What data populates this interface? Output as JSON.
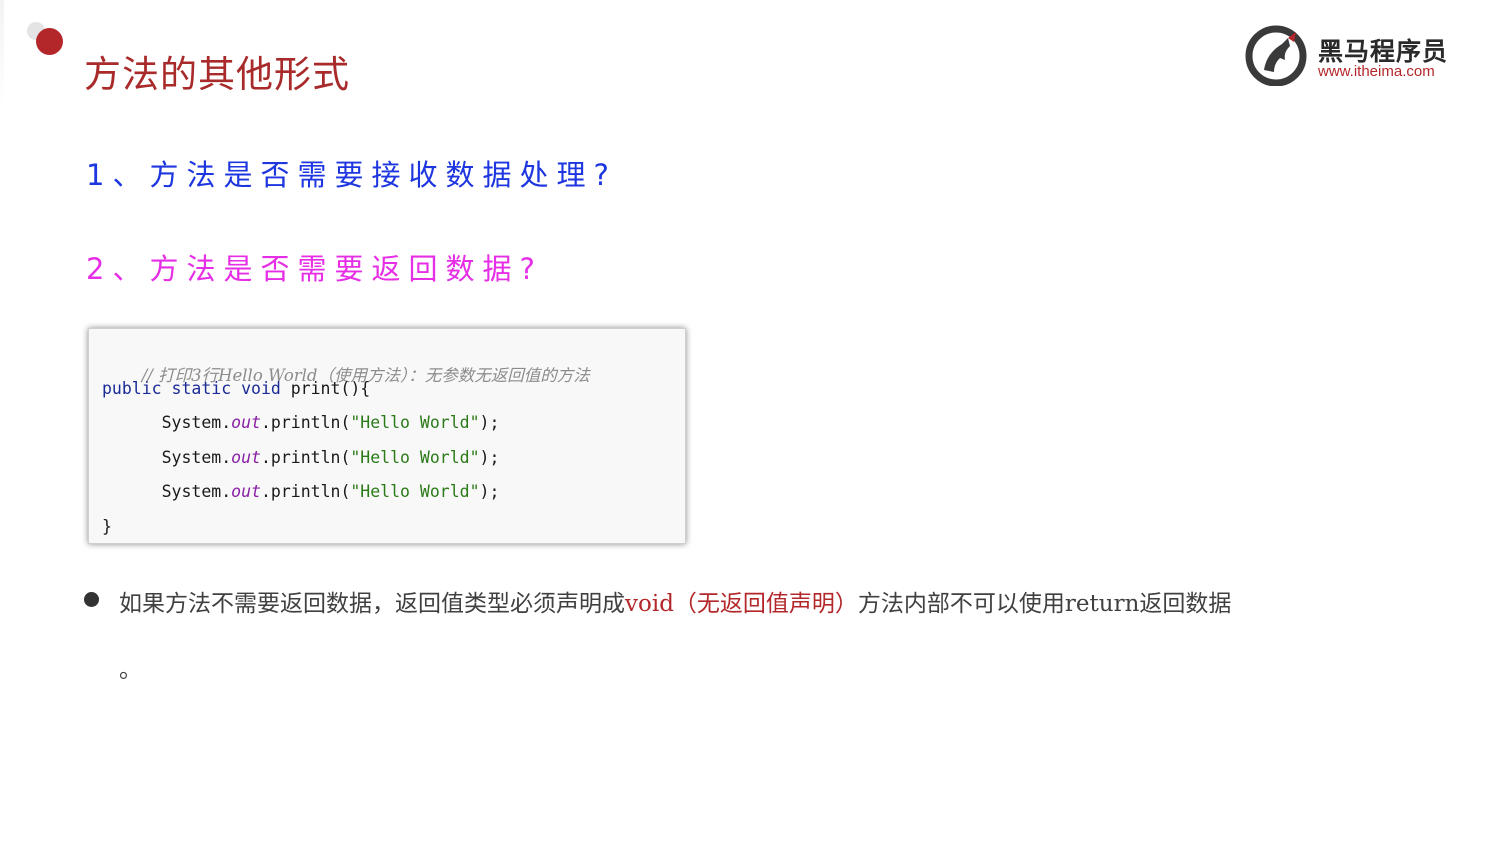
{
  "slide": {
    "title": "方法的其他形式"
  },
  "logo": {
    "name": "黑马程序员",
    "url": "www.itheima.com"
  },
  "questions": [
    "1、方法是否需要接收数据处理?",
    "2、方法是否需要返回数据?"
  ],
  "code": {
    "comment": "// 打印3行Hello World（使用方法）：无参数无返回值的方法",
    "signature_keywords": "public static void",
    "signature_rest": " print(){",
    "println_prefix": "System.",
    "println_field": "out",
    "println_call": ".println(",
    "println_string": "\"Hello World\"",
    "println_suffix": ");",
    "closing": "}"
  },
  "note": {
    "part1": "如果方法不需要返回数据，返回值类型必须声明成",
    "highlight": "void（无返回值声明）",
    "part2": "方法内部不可以使用return返回数据",
    "tail": "。"
  },
  "colors": {
    "title": "#a82a2a",
    "question1": "#1d36e0",
    "question2": "#e52ee5",
    "highlight": "#b3272a"
  }
}
